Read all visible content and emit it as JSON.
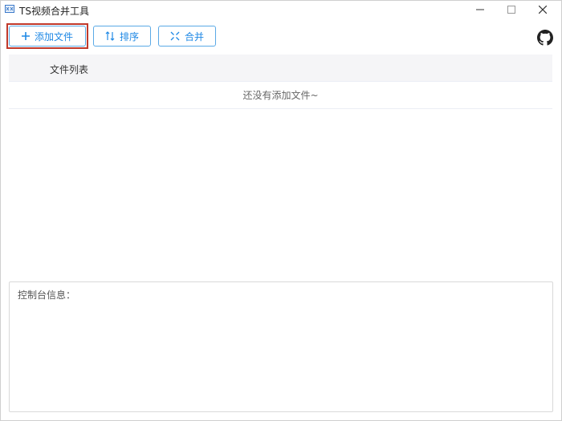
{
  "window": {
    "title": "TS视频合并工具"
  },
  "toolbar": {
    "add_label": "添加文件",
    "sort_label": "排序",
    "merge_label": "合并"
  },
  "file_list": {
    "header": "文件列表",
    "empty_text": "还没有添加文件~"
  },
  "console": {
    "label": "控制台信息："
  },
  "colors": {
    "accent": "#1e88e5",
    "button_border": "#5aa9e6",
    "highlight": "#c0392b",
    "header_bg": "#f5f5f7"
  },
  "icons": {
    "app": "app-icon",
    "add": "plus-icon",
    "sort": "sort-icon",
    "merge": "merge-icon",
    "github": "github-icon"
  }
}
